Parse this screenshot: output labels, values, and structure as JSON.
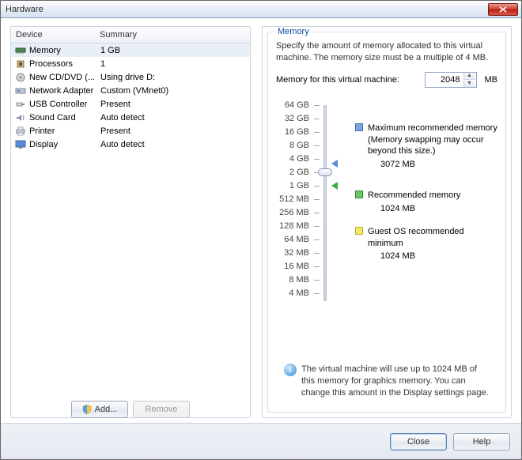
{
  "window": {
    "title": "Hardware"
  },
  "table": {
    "headers": {
      "device": "Device",
      "summary": "Summary"
    },
    "rows": [
      {
        "icon": "memory-icon",
        "name": "Memory",
        "summary": "1 GB",
        "selected": true
      },
      {
        "icon": "cpu-icon",
        "name": "Processors",
        "summary": "1"
      },
      {
        "icon": "cd-icon",
        "name": "New CD/DVD (...",
        "summary": "Using drive D:"
      },
      {
        "icon": "nic-icon",
        "name": "Network Adapter",
        "summary": "Custom (VMnet0)"
      },
      {
        "icon": "usb-icon",
        "name": "USB Controller",
        "summary": "Present"
      },
      {
        "icon": "sound-icon",
        "name": "Sound Card",
        "summary": "Auto detect"
      },
      {
        "icon": "printer-icon",
        "name": "Printer",
        "summary": "Present"
      },
      {
        "icon": "display-icon",
        "name": "Display",
        "summary": "Auto detect"
      }
    ]
  },
  "left_buttons": {
    "add": "Add...",
    "remove": "Remove"
  },
  "memory": {
    "group_label": "Memory",
    "spec": "Specify the amount of memory allocated to this virtual machine. The memory size must be a multiple of 4 MB.",
    "input_label": "Memory for this virtual machine:",
    "value": "2048",
    "unit": "MB",
    "ticks": [
      "64 GB",
      "32 GB",
      "16 GB",
      "8 GB",
      "4 GB",
      "2 GB",
      "1 GB",
      "512 MB",
      "256 MB",
      "128 MB",
      "64 MB",
      "32 MB",
      "16 MB",
      "8 MB",
      "4 MB"
    ],
    "legend": {
      "max": {
        "label": "Maximum recommended memory",
        "note": "(Memory swapping may occur beyond this size.)",
        "value": "3072 MB"
      },
      "rec": {
        "label": "Recommended memory",
        "value": "1024 MB"
      },
      "min": {
        "label": "Guest OS recommended minimum",
        "value": "1024 MB"
      }
    },
    "info": "The virtual machine will use up to 1024 MB of this memory for graphics memory. You can change this amount in the Display settings page."
  },
  "bottom": {
    "close": "Close",
    "help": "Help"
  }
}
